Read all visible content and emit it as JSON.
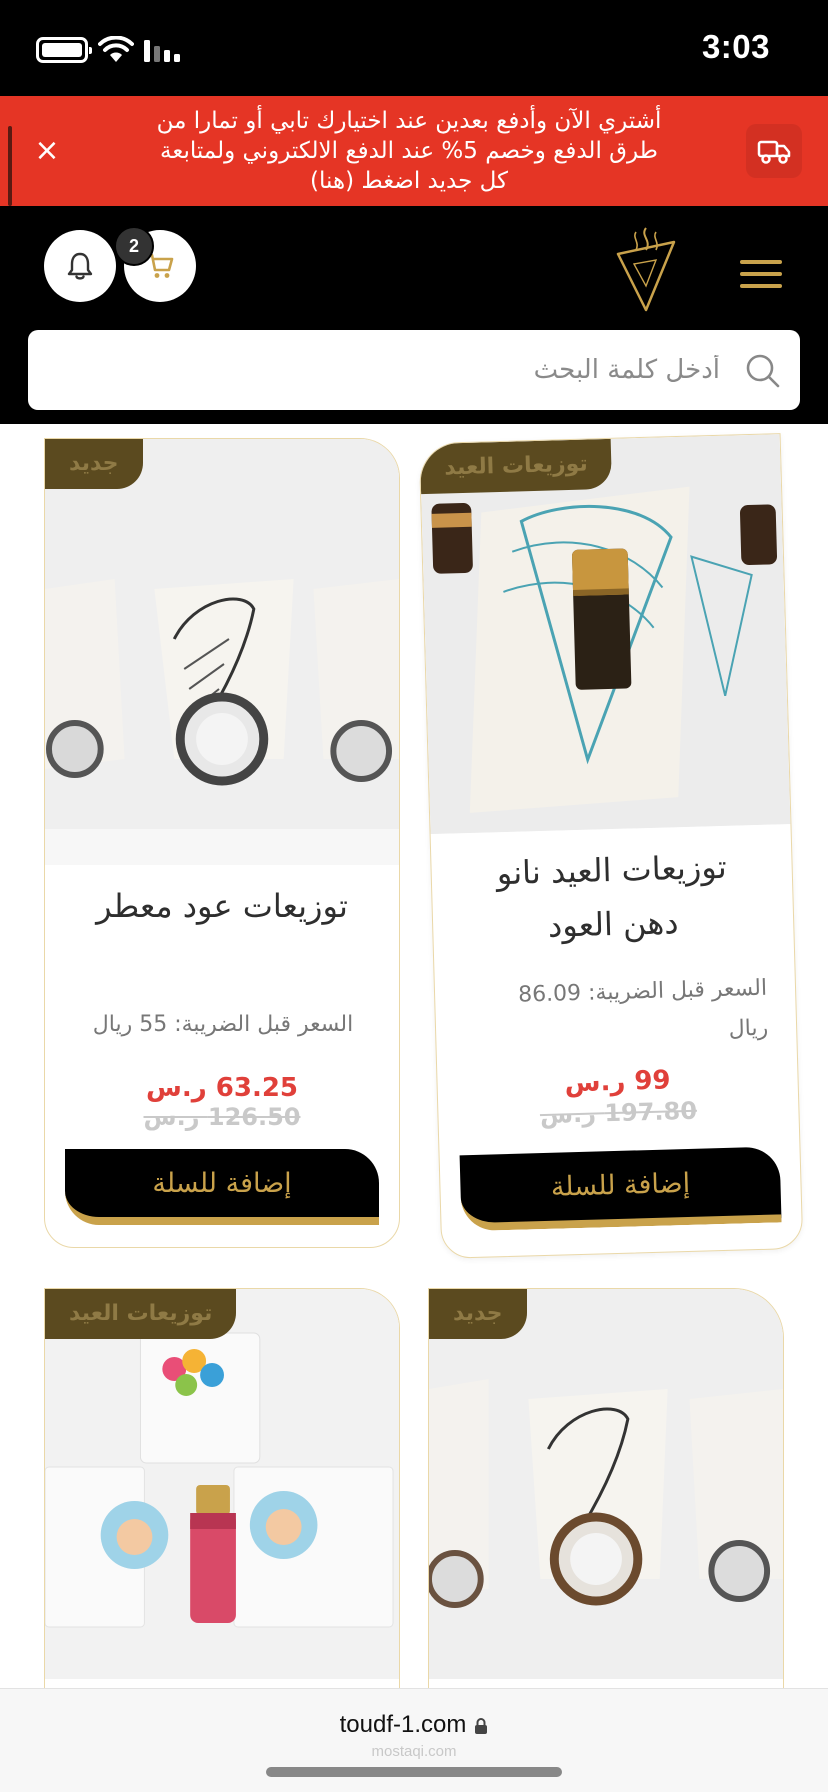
{
  "status_bar": {
    "time": "3:03",
    "icons": [
      "battery-icon",
      "wifi-icon",
      "signal-icon"
    ]
  },
  "promo": {
    "text_line1": "أشتري الآن وأدفع بعدين عند اختيارك تابي أو تمارا من",
    "text_line2": "طرق الدفع وخصم 5% عند الدفع الالكتروني ولمتابعة",
    "text_line3": "كل جديد اضغط (هنا)",
    "close_label": "×",
    "accent_color": "#e53525"
  },
  "header": {
    "cart_count": "2",
    "search_placeholder": "أدخل كلمة البحث",
    "accent_color": "#c9a24b"
  },
  "products": [
    {
      "tag": "توزيعات العيد",
      "title_line1": "توزيعات العيد نانو",
      "title_line2": "دهن العود",
      "tax_line1": "السعر قبل الضريبة: 86.09",
      "tax_line2": "ريال",
      "price": "99 ر.س",
      "old_price": "197.80 ر.س",
      "add_label": "إضافة للسلة"
    },
    {
      "tag": "جديد",
      "title": "توزيعات عود معطر",
      "tax": "السعر قبل الضريبة: 55 ريال",
      "price": "63.25 ر.س",
      "old_price": "126.50 ر.س",
      "add_label": "إضافة للسلة"
    },
    {
      "tag": "جديد"
    },
    {
      "tag": "توزيعات العيد"
    }
  ],
  "browser": {
    "url": "toudf-1.com",
    "watermark": "mostaqi.com"
  }
}
